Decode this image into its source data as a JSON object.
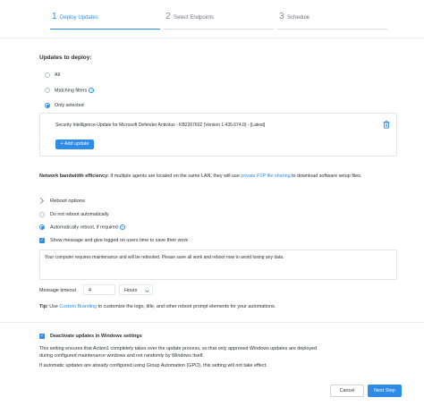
{
  "steps": [
    {
      "num": "1",
      "label": "Deploy Updates"
    },
    {
      "num": "2",
      "label": "Select Endpoints"
    },
    {
      "num": "3",
      "label": "Schedule"
    }
  ],
  "updates": {
    "title": "Updates to deploy:",
    "option_all": "All",
    "option_matching": "Matching filters",
    "option_selected": "Only selected",
    "selected_item": "Security Intelligence-Update for Microsoft Defender Antivirus - KB2267602 (Version 1.435.674.0) - [Latest]",
    "add_button": "+ Add update"
  },
  "network": {
    "label": "Network bandwidth efficiency:",
    "text_before": " If multiple agents are located on the same LAN, they will use ",
    "link": "private P2P file sharing",
    "text_after": " to download software setup files."
  },
  "reboot": {
    "title": "Reboot options",
    "option_no": "Do not reboot automatically",
    "option_auto": "Automatically reboot, if required",
    "show_message": "Show message and give logged on users time to save their work",
    "message": "Your computer requires maintenance and will be rebooted. Please save all work and reboot now to avoid losing any data.",
    "timeout_label": "Message timeout",
    "timeout_value": "4",
    "timeout_unit": "Hours",
    "tip_label": "Tip:",
    "tip_before": " Use ",
    "tip_link": "Custom Branding",
    "tip_after": " to customize the logo, title, and other reboot prompt elements for your automations."
  },
  "windows": {
    "title": "Deactivate updates in Windows settings",
    "desc1": "This setting ensures that Action1 completely takes over the update process, so that only approved Windows updates are deployed",
    "desc2": "during configured maintenance windows and not randomly by Windows itself.",
    "desc3": "If automatic updates are already configured using Group Automation (GPO), this setting will not take effect."
  },
  "footer": {
    "cancel": "Cancel",
    "next": "Next Step"
  },
  "colors": {
    "accent": "#2e8be8",
    "text": "#2b2f36",
    "border": "#e2e5e9"
  },
  "icons": {
    "delete": "trash-icon",
    "help": "question-circle-icon",
    "select": "chevron-down-icon"
  }
}
